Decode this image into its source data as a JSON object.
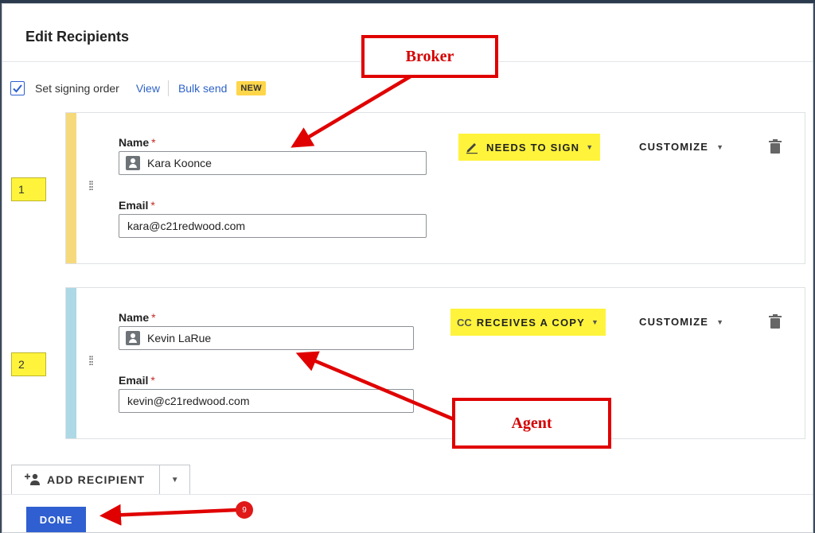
{
  "dialog": {
    "title": "Edit Recipients"
  },
  "signing_order": {
    "checked": true,
    "label": "Set signing order",
    "view_link": "View",
    "bulk_send_link": "Bulk send",
    "new_badge": "NEW"
  },
  "recipients": [
    {
      "order": "1",
      "stripe_color": "#f6d97b",
      "name_label": "Name",
      "name_value": "Kara Koonce",
      "email_label": "Email",
      "email_value": "kara@c21redwood.com",
      "role": "NEEDS TO SIGN",
      "role_icon": "pen-icon",
      "customize": "CUSTOMIZE"
    },
    {
      "order": "2",
      "stripe_color": "#add8e6",
      "name_label": "Name",
      "name_value": "Kevin LaRue",
      "email_label": "Email",
      "email_value": "kevin@c21redwood.com",
      "role": "RECEIVES A COPY",
      "role_icon_text": "CC",
      "customize": "CUSTOMIZE"
    }
  ],
  "required_marker": "*",
  "add_recipient": {
    "label": "ADD RECIPIENT"
  },
  "footer": {
    "done_label": "DONE"
  },
  "annotations": {
    "broker": "Broker",
    "agent": "Agent",
    "step_number": "9"
  },
  "colors": {
    "accent": "#2f5fd0",
    "highlight": "#fff43b",
    "annotation_red": "#e00000"
  }
}
